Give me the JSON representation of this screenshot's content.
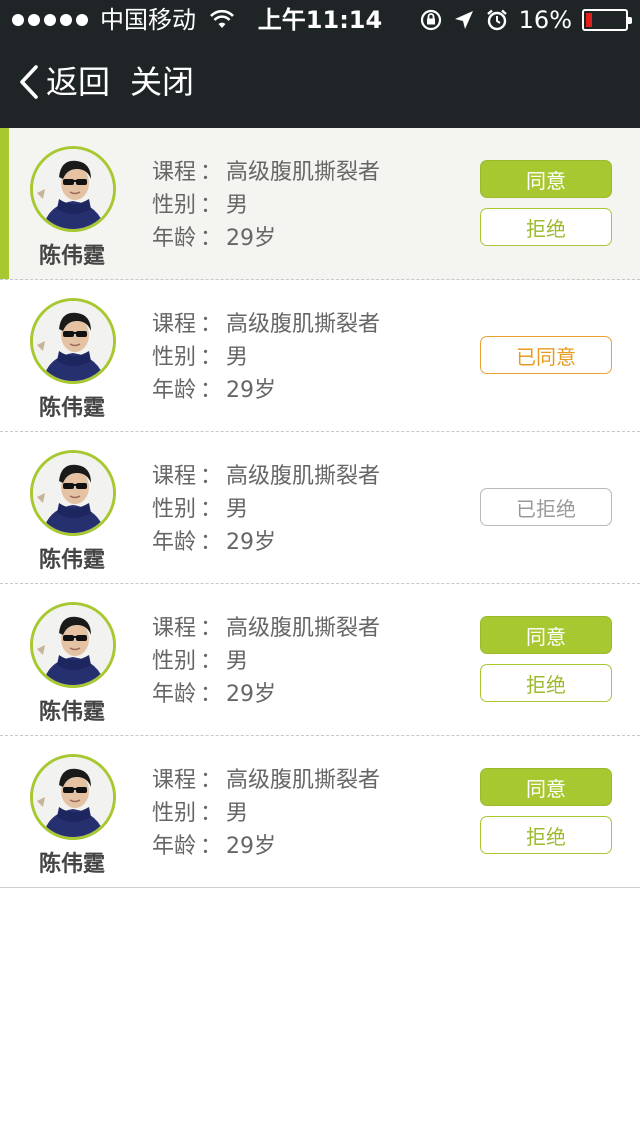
{
  "status_bar": {
    "carrier": "中国移动",
    "time": "上午11:14",
    "battery_percent": "16%",
    "battery_level": 0.16,
    "icons": [
      "signal-dots-icon",
      "wifi-icon",
      "rotation-lock-icon",
      "location-icon",
      "alarm-icon",
      "battery-icon"
    ]
  },
  "nav": {
    "back_label": "返回",
    "close_label": "关闭"
  },
  "labels": {
    "course": "课程",
    "gender": "性别",
    "age": "年龄",
    "colon": "："
  },
  "colors": {
    "accent": "#a8c832",
    "agreed": "#eaa233",
    "rejected": "#b8b8b8",
    "header": "#1f2527"
  },
  "requests": [
    {
      "name": "陈伟霆",
      "course": "高级腹肌撕裂者",
      "gender": "男",
      "age": "29岁",
      "state": "pending",
      "agree_label": "同意",
      "reject_label": "拒绝",
      "selected": true
    },
    {
      "name": "陈伟霆",
      "course": "高级腹肌撕裂者",
      "gender": "男",
      "age": "29岁",
      "state": "agreed",
      "status_label": "已同意"
    },
    {
      "name": "陈伟霆",
      "course": "高级腹肌撕裂者",
      "gender": "男",
      "age": "29岁",
      "state": "rejected",
      "status_label": "已拒绝"
    },
    {
      "name": "陈伟霆",
      "course": "高级腹肌撕裂者",
      "gender": "男",
      "age": "29岁",
      "state": "pending",
      "agree_label": "同意",
      "reject_label": "拒绝"
    },
    {
      "name": "陈伟霆",
      "course": "高级腹肌撕裂者",
      "gender": "男",
      "age": "29岁",
      "state": "pending",
      "agree_label": "同意",
      "reject_label": "拒绝"
    }
  ]
}
